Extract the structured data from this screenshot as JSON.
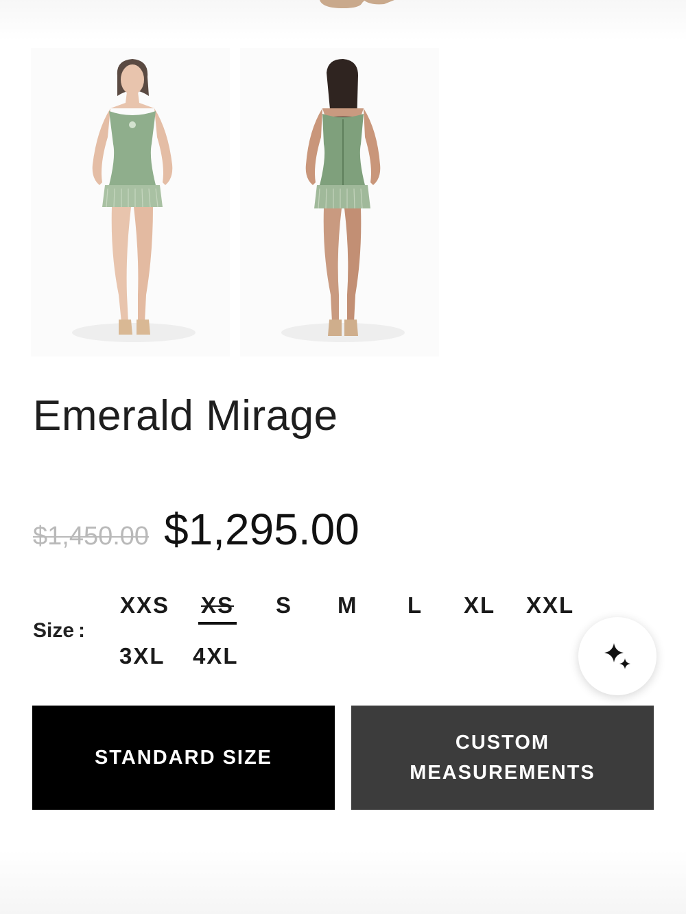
{
  "product": {
    "title": "Emerald Mirage",
    "original_price": "$1,450.00",
    "sale_price": "$1,295.00"
  },
  "gallery": {
    "images": [
      {
        "alt": "front view"
      },
      {
        "alt": "back view"
      }
    ]
  },
  "size": {
    "label": "Size :",
    "options": [
      {
        "label": "XXS",
        "state": "available"
      },
      {
        "label": "XS",
        "state": "selected-unavailable"
      },
      {
        "label": "S",
        "state": "available"
      },
      {
        "label": "M",
        "state": "available"
      },
      {
        "label": "L",
        "state": "available"
      },
      {
        "label": "XL",
        "state": "available"
      },
      {
        "label": "XXL",
        "state": "available"
      },
      {
        "label": "3XL",
        "state": "available"
      },
      {
        "label": "4XL",
        "state": "available"
      }
    ]
  },
  "actions": {
    "standard_label": "STANDARD SIZE",
    "custom_label": "CUSTOM MEASUREMENTS"
  },
  "fab": {
    "icon": "sparkles-icon"
  },
  "colors": {
    "primary_button": "#000000",
    "secondary_button": "#3c3c3c",
    "old_price": "#b9b9b9",
    "dress_green": "#8fae8c"
  }
}
